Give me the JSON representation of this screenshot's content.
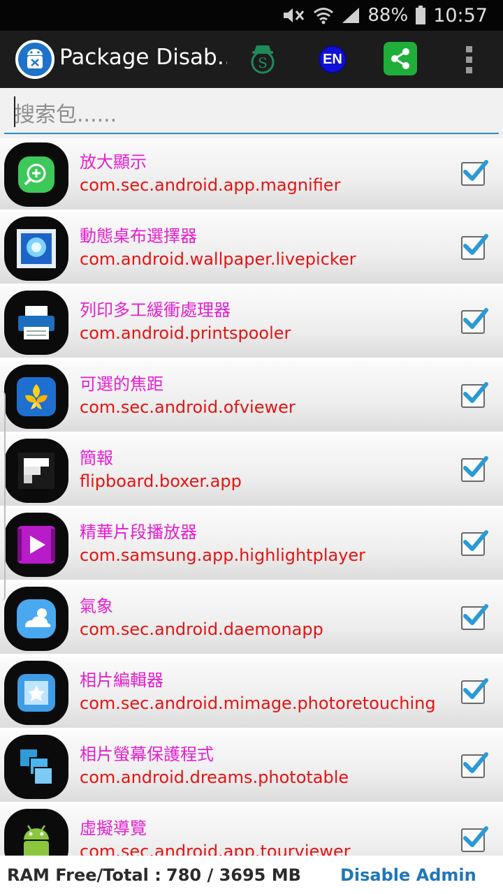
{
  "status_bar": {
    "battery": "88%",
    "time": "10:57"
  },
  "app_bar": {
    "title": "Package Disab…",
    "en_label": "EN"
  },
  "search": {
    "placeholder": "搜索包......"
  },
  "apps": [
    {
      "name": "放大顯示",
      "package": "com.sec.android.app.magnifier",
      "checked": true,
      "icon": "magnifier-icon"
    },
    {
      "name": "動態桌布選擇器",
      "package": "com.android.wallpaper.livepicker",
      "checked": true,
      "icon": "live-wallpaper-icon"
    },
    {
      "name": "列印多工緩衝處理器",
      "package": "com.android.printspooler",
      "checked": true,
      "icon": "printer-icon"
    },
    {
      "name": "可選的焦距",
      "package": "com.sec.android.ofviewer",
      "checked": true,
      "icon": "flower-focus-icon"
    },
    {
      "name": "簡報",
      "package": "flipboard.boxer.app",
      "checked": true,
      "icon": "flipboard-icon"
    },
    {
      "name": "精華片段播放器",
      "package": "com.samsung.app.highlightplayer",
      "checked": true,
      "icon": "video-player-icon"
    },
    {
      "name": "氣象",
      "package": "com.sec.android.daemonapp",
      "checked": true,
      "icon": "weather-icon"
    },
    {
      "name": "相片編輯器",
      "package": "com.sec.android.mimage.photoretouching",
      "checked": true,
      "icon": "photo-editor-icon"
    },
    {
      "name": "相片螢幕保護程式",
      "package": "com.android.dreams.phototable",
      "checked": true,
      "icon": "photo-table-icon"
    },
    {
      "name": "虛擬導覽",
      "package": "com.sec.android.app.tourviewer",
      "checked": true,
      "icon": "android-robot-icon"
    }
  ],
  "footer": {
    "ram_label": "RAM Free/Total :",
    "ram_value": "780 / 3695 MB",
    "disable_admin": "Disable Admin"
  },
  "colors": {
    "app_name": "#e41fd0",
    "package_name": "#e41414",
    "accent": "#2a8cc4",
    "link": "#1f77b8"
  }
}
